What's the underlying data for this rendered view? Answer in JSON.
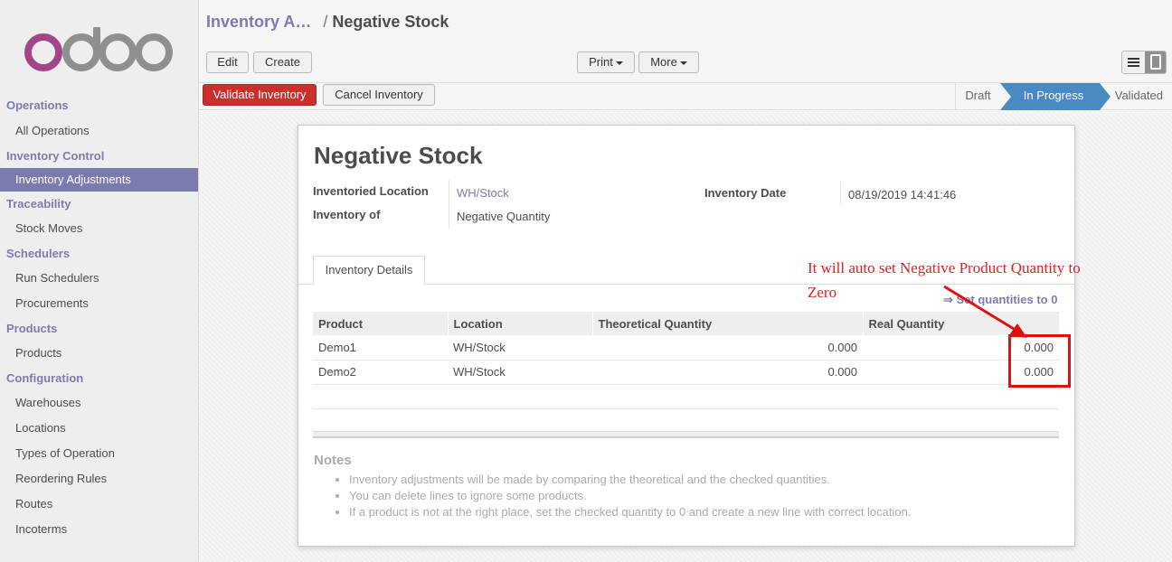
{
  "sidebar": {
    "logo_text": "odoo",
    "sections": [
      {
        "title": "Operations",
        "items": [
          "All Operations"
        ]
      },
      {
        "title": "Inventory Control",
        "items": [
          "Inventory Adjustments"
        ]
      },
      {
        "title": "Traceability",
        "items": [
          "Stock Moves"
        ]
      },
      {
        "title": "Schedulers",
        "items": [
          "Run Schedulers",
          "Procurements"
        ]
      },
      {
        "title": "Products",
        "items": [
          "Products"
        ]
      },
      {
        "title": "Configuration",
        "items": [
          "Warehouses",
          "Locations",
          "Types of Operation",
          "Reordering Rules",
          "Routes",
          "Incoterms"
        ]
      }
    ],
    "active_item": "Inventory Adjustments"
  },
  "breadcrumb": {
    "parent": "Inventory A…",
    "separator": "/",
    "current": "Negative Stock"
  },
  "toolbar": {
    "edit_label": "Edit",
    "create_label": "Create",
    "print_label": "Print",
    "more_label": "More"
  },
  "statusbar": {
    "validate_label": "Validate Inventory",
    "cancel_label": "Cancel Inventory",
    "stages": [
      "Draft",
      "In Progress",
      "Validated"
    ],
    "current_stage": "In Progress"
  },
  "form": {
    "title": "Negative Stock",
    "inventoried_location_label": "Inventoried Location",
    "inventoried_location_value": "WH/Stock",
    "inventory_of_label": "Inventory of",
    "inventory_of_value": "Negative Quantity",
    "inventory_date_label": "Inventory Date",
    "inventory_date_value": "08/19/2019 14:41:46",
    "tab_label": "Inventory Details",
    "set_quantities_label": "⇒ Set quantities to 0",
    "table": {
      "headers": [
        "Product",
        "Location",
        "Theoretical Quantity",
        "Real Quantity"
      ],
      "rows": [
        [
          "Demo1",
          "WH/Stock",
          "0.000",
          "0.000"
        ],
        [
          "Demo2",
          "WH/Stock",
          "0.000",
          "0.000"
        ]
      ]
    },
    "notes_title": "Notes",
    "notes": [
      "Inventory adjustments will be made by comparing the theoretical and the checked quantities.",
      "You can delete lines to ignore some products.",
      "If a product is not at the right place, set the checked quantity to 0 and create a new line with correct location."
    ]
  },
  "annotation": {
    "text": "It will auto set Negative Product Quantity to Zero",
    "color": "#e02020"
  },
  "colors": {
    "brand": "#7c7bad",
    "danger": "#c9302c",
    "stage_active": "#4a8ac2"
  }
}
